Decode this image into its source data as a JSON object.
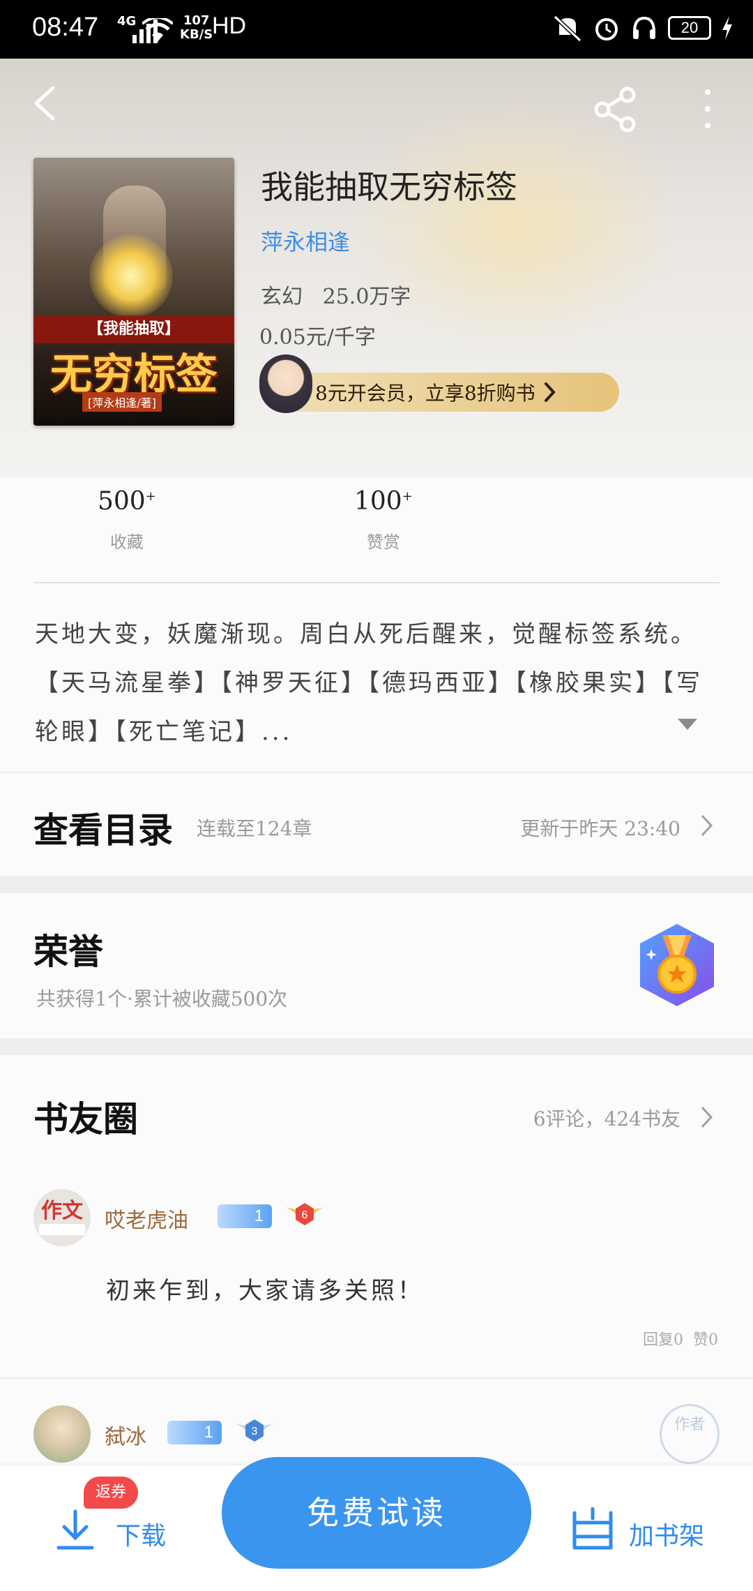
{
  "status_bar": {
    "time": "08:47",
    "network": "4G",
    "speed_value": "107",
    "speed_unit": "KB/S",
    "hd": "HD",
    "battery": "20"
  },
  "book": {
    "title": "我能抽取无穷标签",
    "author": "萍永相逢",
    "genre_words": "玄幻   25.0万字",
    "price": "0.05元/千字",
    "cover_band": "【我能抽取】",
    "cover_title": "无穷标签",
    "cover_author": "[萍永相逢/著]"
  },
  "vip_banner": {
    "text": "8元开会员，立享8折购书"
  },
  "stats": [
    {
      "num": "500",
      "suffix": "+",
      "label": "收藏"
    },
    {
      "num": "100",
      "suffix": "+",
      "label": "赞赏"
    }
  ],
  "description": "天地大变，妖魔渐现。周白从死后醒来，觉醒标签系统。【天马流星拳】【神罗天征】【德玛西亚】【橡胶果实】【写轮眼】【死亡笔记】...",
  "catalog": {
    "title": "查看目录",
    "status": "连载至124章",
    "updated": "更新于昨天 23:40"
  },
  "honor": {
    "title": "荣誉",
    "summary": "共获得1个·累计被收藏500次"
  },
  "friends": {
    "title": "书友圈",
    "summary": "6评论，424书友",
    "posts": [
      {
        "user": "哎老虎油",
        "level": "1",
        "rank": "6",
        "avatar_text": "作文",
        "text": "初来乍到，大家请多关照！",
        "stats": "回复0  赞0"
      },
      {
        "user": "弑冰",
        "level": "1",
        "rank": "3",
        "stamp": "作者"
      }
    ]
  },
  "bottom_bar": {
    "download": "下载",
    "download_badge": "返券",
    "free_read": "免费试读",
    "add_shelf": "加书架"
  },
  "colors": {
    "accent": "#3a95ef",
    "author_link": "#3d8fe8",
    "username": "#9b6a3c",
    "badge_red": "#f24a4a"
  }
}
